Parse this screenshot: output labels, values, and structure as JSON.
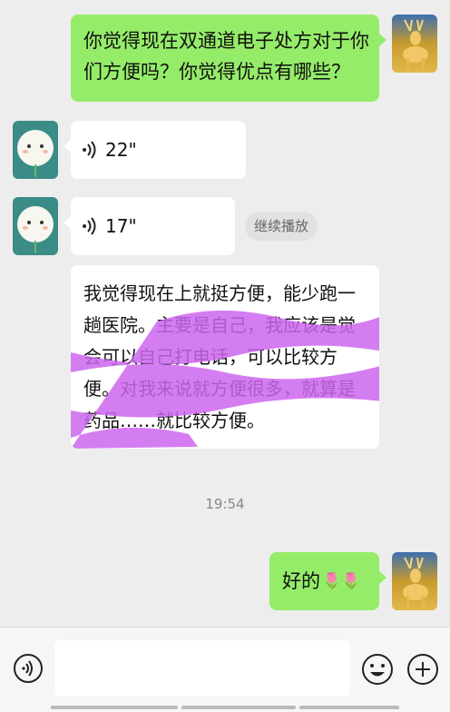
{
  "messages": {
    "m1": {
      "text": "你觉得现在双通道电子处方对于你们方便吗？你觉得优点有哪些？"
    },
    "m2": {
      "duration": "22\""
    },
    "m3": {
      "duration": "17\"",
      "replay_label": "继续播放"
    },
    "m4": {
      "text": "我觉得现在上就挺方便，能少跑一趟医院。主要是自己，我应该是觉会可以自己打电话，可以比较方便。对我来说就方便很多，就算是药品……就比较方便。"
    },
    "timestamp": "19:54",
    "m5": {
      "text": "好的",
      "emoji": "🌷🌷"
    }
  },
  "colors": {
    "self_bubble": "#95ec69",
    "other_bubble": "#ffffff",
    "background": "#ededed",
    "redaction": "#cc66ee"
  },
  "icons": {
    "voice_toggle": "voice-mode-icon",
    "emoji": "emoji-icon",
    "more": "plus-icon"
  }
}
